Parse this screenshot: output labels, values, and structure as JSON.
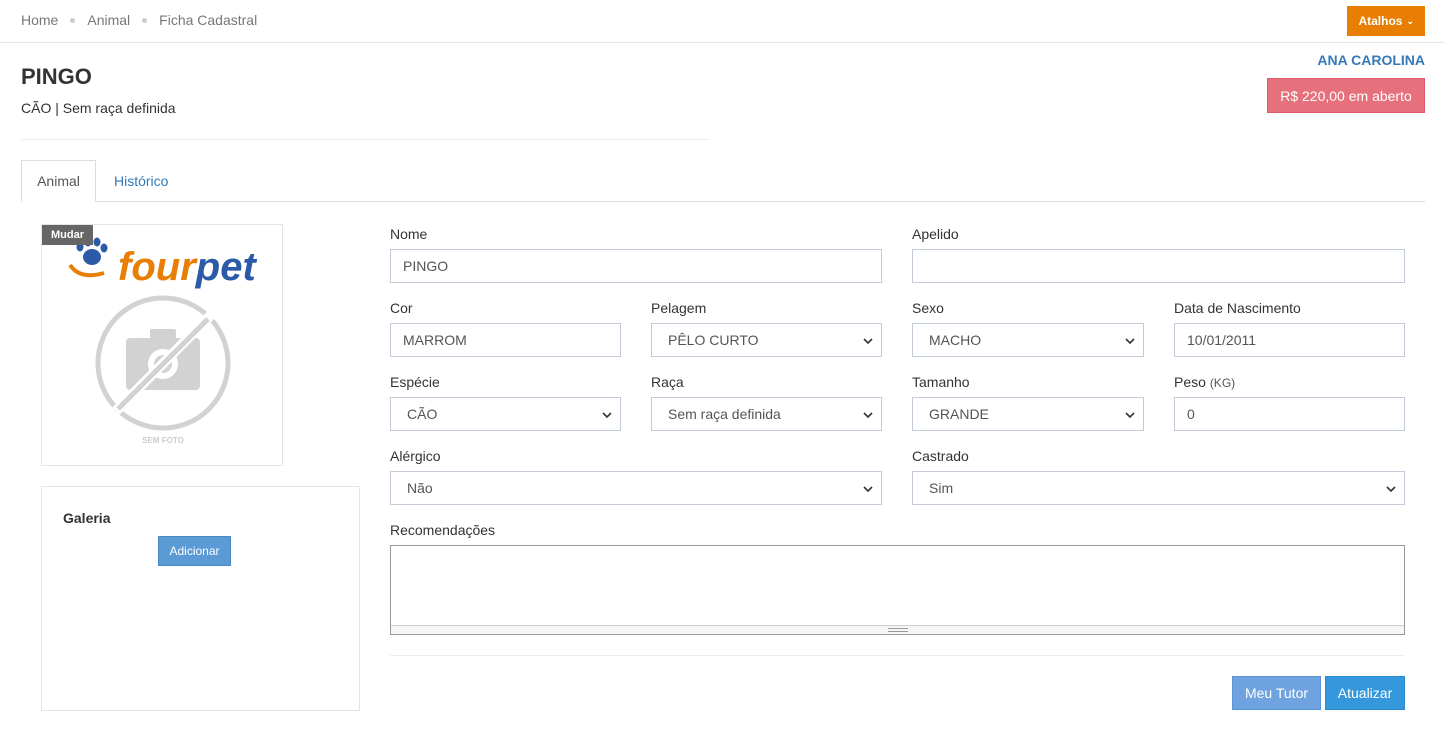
{
  "breadcrumb": [
    "Home",
    "Animal",
    "Ficha Cadastral"
  ],
  "shortcuts_label": "Atalhos",
  "pet": {
    "name": "PINGO",
    "subtitle": "CÃO | Sem raça definida"
  },
  "tutor_name": "ANA CAROLINA",
  "open_balance": "R$ 220,00 em aberto",
  "tabs": [
    {
      "label": "Animal",
      "active": true
    },
    {
      "label": "Histórico",
      "active": false
    }
  ],
  "photo": {
    "change_label": "Mudar",
    "logo_text": "fourpet",
    "no_photo_text": "SEM FOTO"
  },
  "gallery": {
    "title": "Galeria",
    "add_label": "Adicionar"
  },
  "form": {
    "nome": {
      "label": "Nome",
      "value": "PINGO"
    },
    "apelido": {
      "label": "Apelido",
      "value": ""
    },
    "cor": {
      "label": "Cor",
      "value": "MARROM"
    },
    "pelagem": {
      "label": "Pelagem",
      "value": "PÊLO CURTO"
    },
    "sexo": {
      "label": "Sexo",
      "value": "MACHO"
    },
    "nascimento": {
      "label": "Data de Nascimento",
      "value": "10/01/2011"
    },
    "especie": {
      "label": "Espécie",
      "value": "CÃO"
    },
    "raca": {
      "label": "Raça",
      "value": "Sem raça definida"
    },
    "tamanho": {
      "label": "Tamanho",
      "value": "GRANDE"
    },
    "peso": {
      "label": "Peso",
      "unit": "(KG)",
      "value": "0"
    },
    "alergico": {
      "label": "Alérgico",
      "value": "Não"
    },
    "castrado": {
      "label": "Castrado",
      "value": "Sim"
    },
    "recomendacoes": {
      "label": "Recomendações",
      "value": ""
    }
  },
  "buttons": {
    "tutor": "Meu Tutor",
    "update": "Atualizar"
  },
  "colors": {
    "accent_orange": "#e87e04",
    "link_blue": "#337ab7",
    "debt_red": "#e7707d",
    "primary_blue": "#3598dc"
  }
}
